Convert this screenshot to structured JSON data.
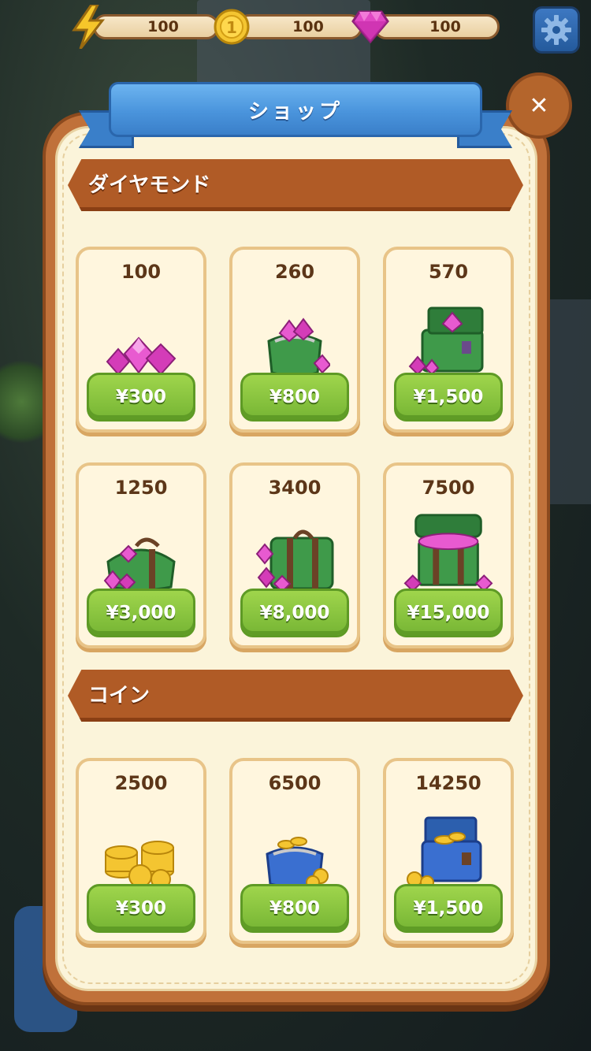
{
  "resources": {
    "energy": {
      "icon": "lightning-icon",
      "value": "100"
    },
    "coins": {
      "icon": "coin-icon",
      "value": "100"
    },
    "gems": {
      "icon": "gem-icon",
      "value": "100"
    }
  },
  "shop": {
    "title": "ショップ",
    "close_icon": "close-icon",
    "settings_icon": "gear-icon"
  },
  "sections": {
    "diamonds": {
      "title": "ダイヤモンド",
      "items": [
        {
          "amount": "100",
          "price": "¥300",
          "art": "small-gem-pile-icon"
        },
        {
          "amount": "260",
          "price": "¥800",
          "art": "gem-purse-icon"
        },
        {
          "amount": "570",
          "price": "¥1,500",
          "art": "gem-satchel-icon"
        },
        {
          "amount": "1250",
          "price": "¥3,000",
          "art": "gem-duffel-bag-icon"
        },
        {
          "amount": "3400",
          "price": "¥8,000",
          "art": "gem-suitcase-icon"
        },
        {
          "amount": "7500",
          "price": "¥15,000",
          "art": "gem-chest-icon"
        }
      ]
    },
    "coins": {
      "title": "コイン",
      "items": [
        {
          "amount": "2500",
          "price": "¥300",
          "art": "coin-stack-icon"
        },
        {
          "amount": "6500",
          "price": "¥800",
          "art": "coin-purse-icon"
        },
        {
          "amount": "14250",
          "price": "¥1,500",
          "art": "coin-satchel-icon"
        }
      ]
    }
  },
  "colors": {
    "panel_brown": "#c0713a",
    "panel_cream": "#fbf4da",
    "ribbon_blue": "#4a94dc",
    "price_green": "#8cc63f",
    "gem_pink": "#e040c0",
    "coin_gold": "#f2c230"
  }
}
